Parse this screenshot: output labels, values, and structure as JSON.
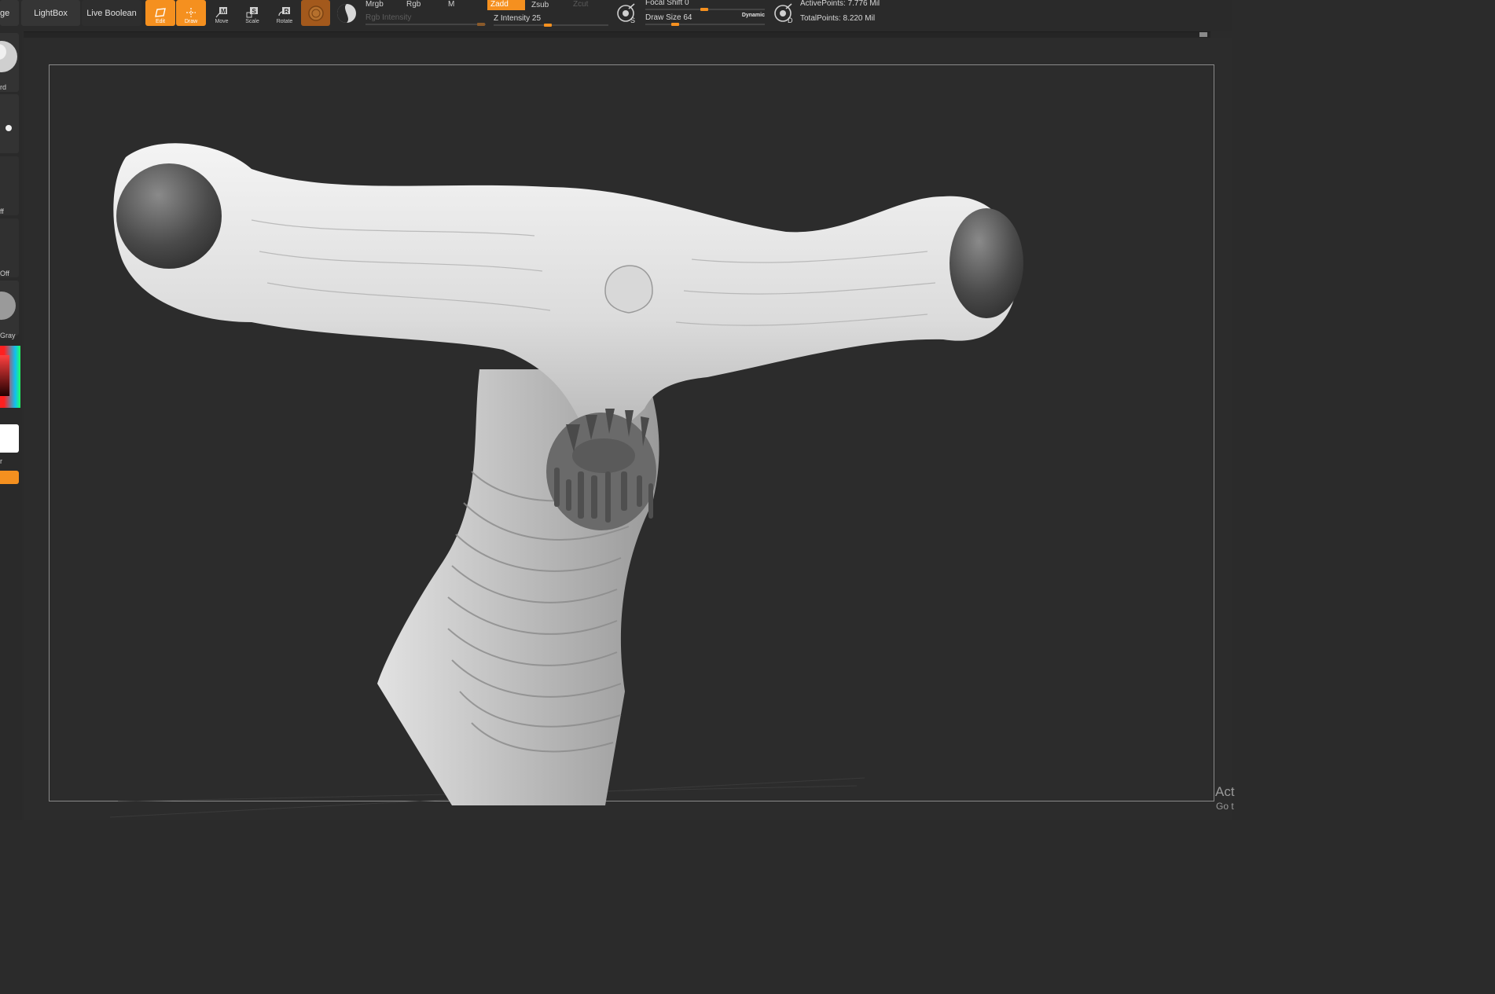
{
  "toolbar": {
    "cut_label": "ge",
    "lightbox_label": "LightBox",
    "live_boolean_label": "Live Boolean",
    "modes": {
      "edit": "Edit",
      "draw": "Draw",
      "move": "Move",
      "scale": "Scale",
      "rotate": "Rotate"
    },
    "channels": {
      "mrgb": "Mrgb",
      "rgb": "Rgb",
      "m": "M",
      "zadd": "Zadd",
      "zsub": "Zsub",
      "zcut": "Zcut"
    },
    "rgb_intensity_label": "Rgb Intensity",
    "z_intensity_label": "Z Intensity",
    "z_intensity_value": "25",
    "focal_shift_label": "Focal Shift",
    "focal_shift_value": "0",
    "draw_size_label": "Draw Size",
    "draw_size_value": "64",
    "dynamic_label": "Dynamic",
    "s_icon_letter": "S",
    "d_icon_letter": "D",
    "active_points": "ActivePoints: 7.776 Mil",
    "total_points": "TotalPoints: 8.220 Mil",
    "accent_color": "#f5901f"
  },
  "left_tray": {
    "labels": [
      "rd",
      "ff",
      "Off",
      "Gray",
      "r"
    ]
  },
  "overlay": {
    "activate_line1": "Act",
    "activate_line2": "Go t"
  }
}
